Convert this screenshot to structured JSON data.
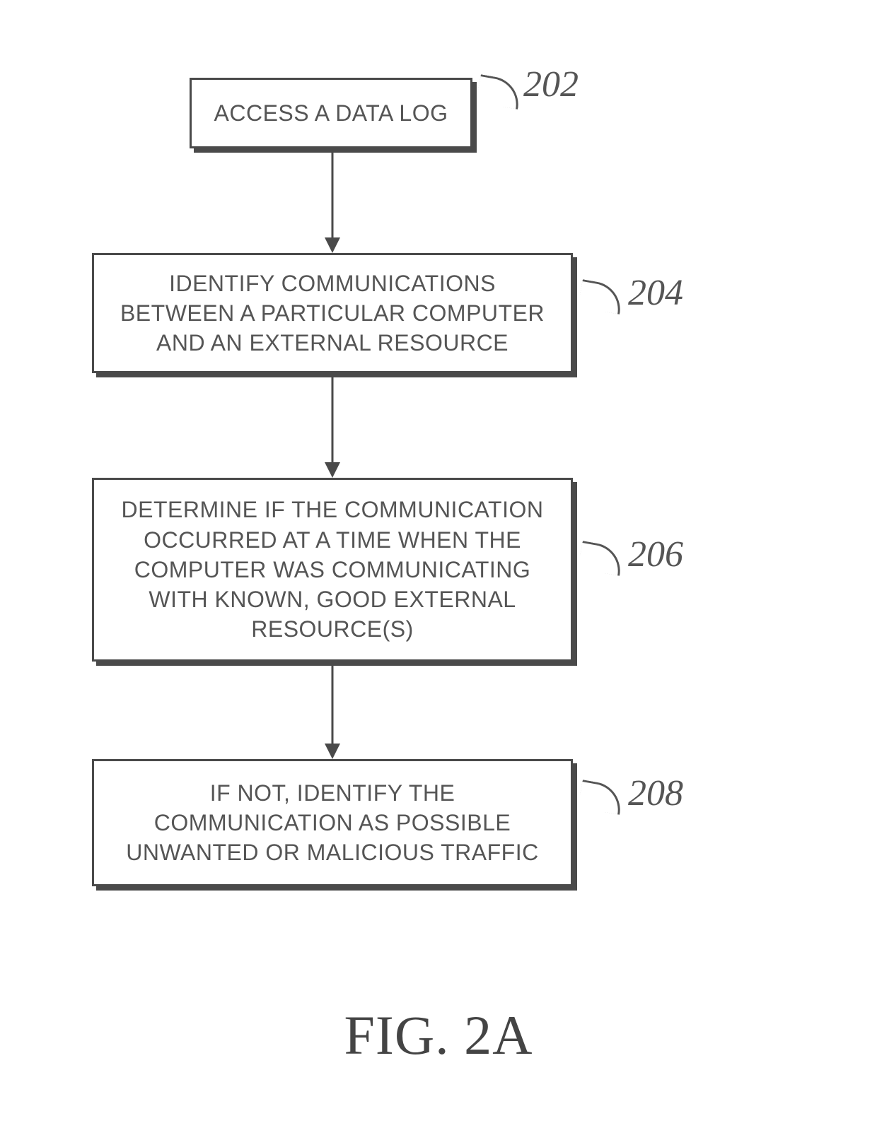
{
  "figure": {
    "caption": "FIG. 2A"
  },
  "steps": [
    {
      "ref": "202",
      "text": "ACCESS A DATA LOG"
    },
    {
      "ref": "204",
      "text": "IDENTIFY COMMUNICATIONS BETWEEN A PARTICULAR COMPUTER AND AN EXTERNAL RESOURCE"
    },
    {
      "ref": "206",
      "text": "DETERMINE IF THE COMMUNICATION OCCURRED AT A TIME WHEN THE COMPUTER WAS COMMUNICATING WITH KNOWN, GOOD EXTERNAL RESOURCE(S)"
    },
    {
      "ref": "208",
      "text": "IF NOT, IDENTIFY THE COMMUNICATION AS POSSIBLE UNWANTED OR MALICIOUS TRAFFIC"
    }
  ]
}
